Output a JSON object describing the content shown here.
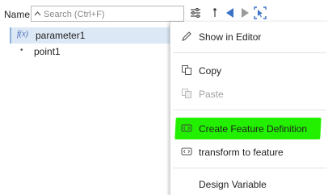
{
  "toolbar": {
    "name_label": "Name",
    "search_placeholder": "Search (Ctrl+F)",
    "icons": [
      "filter-settings-icon",
      "dot-menu-icon",
      "back-arrow-icon",
      "forward-arrow-icon",
      "select-tool-icon"
    ]
  },
  "tree": {
    "items": [
      {
        "label": "parameter1",
        "icon": "fx-icon",
        "badge": "f(x)",
        "selected": true
      },
      {
        "label": "point1",
        "icon": "point-icon",
        "badge": "•",
        "selected": false
      }
    ]
  },
  "context_menu": {
    "items": [
      {
        "label": "Show in Editor",
        "icon": "pencil-icon",
        "enabled": true
      },
      {
        "label": "Copy",
        "icon": "copy-icon",
        "enabled": true
      },
      {
        "label": "Paste",
        "icon": "paste-icon",
        "enabled": false
      },
      {
        "label": "Create Feature Definition",
        "icon": "feature-icon",
        "enabled": true,
        "highlighted": true
      },
      {
        "label": "transform to feature",
        "icon": "feature-icon",
        "enabled": true
      },
      {
        "label": "Design Variable",
        "icon": "",
        "enabled": true
      }
    ]
  },
  "colors": {
    "accent_blue": "#3a72c8",
    "highlight_green": "#22f000",
    "selection_bg": "#dce8f5"
  }
}
